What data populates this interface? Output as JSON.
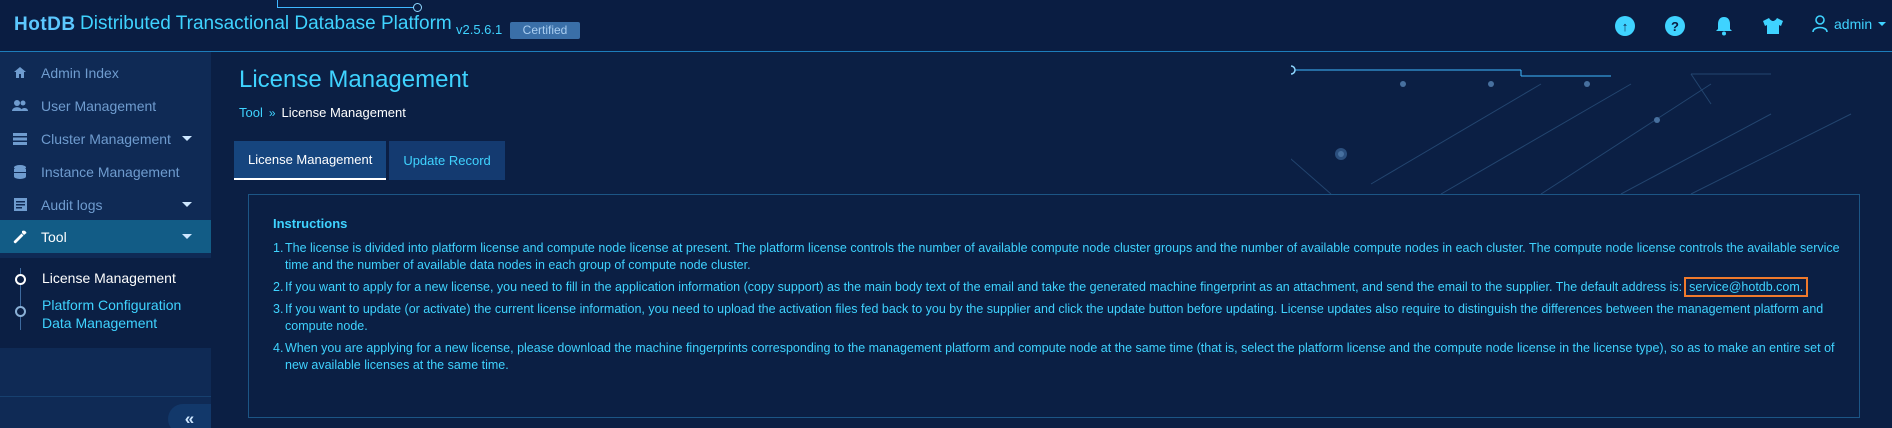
{
  "header": {
    "logo": "HotDB",
    "title": "Distributed Transactional Database Platform",
    "version": "v2.5.6.1",
    "badge": "Certified",
    "username": "admin",
    "icons": [
      "upload-icon",
      "help-icon",
      "bell-icon",
      "tshirt-icon",
      "user-icon"
    ]
  },
  "sidebar": {
    "items": [
      {
        "label": "Admin Index",
        "icon": "home-icon"
      },
      {
        "label": "User Management",
        "icon": "users-icon"
      },
      {
        "label": "Cluster Management",
        "icon": "list-icon",
        "expandable": true
      },
      {
        "label": "Instance Management",
        "icon": "database-icon"
      },
      {
        "label": "Audit logs",
        "icon": "document-icon",
        "expandable": true
      },
      {
        "label": "Tool",
        "icon": "wrench-icon",
        "expandable": true,
        "active": true
      }
    ],
    "subitems": [
      {
        "label": "License Management",
        "active": true
      },
      {
        "label": "Platform Configuration Data Management",
        "active": false
      }
    ],
    "collapse_label": "«"
  },
  "main": {
    "title": "License Management",
    "breadcrumb": {
      "root": "Tool",
      "separator": "»",
      "current": "License Management"
    },
    "tabs": [
      {
        "label": "License Management",
        "active": true
      },
      {
        "label": "Update Record",
        "active": false
      }
    ],
    "instructions_title": "Instructions",
    "instructions": [
      {
        "num": "1.",
        "text": "The license is divided into platform license and compute node license at present. The platform license controls the number of available compute node cluster groups and the number of available compute nodes in each cluster. The compute node license controls the available service time and the number of available data nodes in each group of compute node cluster."
      },
      {
        "num": "2.",
        "text": "If you want to apply for a new license, you need to fill in the application information (copy support) as the main body text of the email and take the generated machine fingerprint as an attachment, and send the email to the supplier. The default address is:",
        "email": "service@hotdb.com."
      },
      {
        "num": "3.",
        "text": "If you want to update (or activate) the current license information, you need to upload the activation files fed back to you by the supplier and click the update button before updating. License updates also require to distinguish the differences between the management platform and compute node."
      },
      {
        "num": "4.",
        "text": "When you are applying for a new license, please download the machine fingerprints corresponding to the management platform and compute node at the same time (that is, select the platform license and the compute node license in the license type), so as to make an entire set of new available licenses at the same time."
      }
    ]
  },
  "colors": {
    "accent": "#3fd3ff",
    "background": "#0b1f44",
    "sidebar_active": "#125c86",
    "highlight_border": "#f07a2c"
  }
}
